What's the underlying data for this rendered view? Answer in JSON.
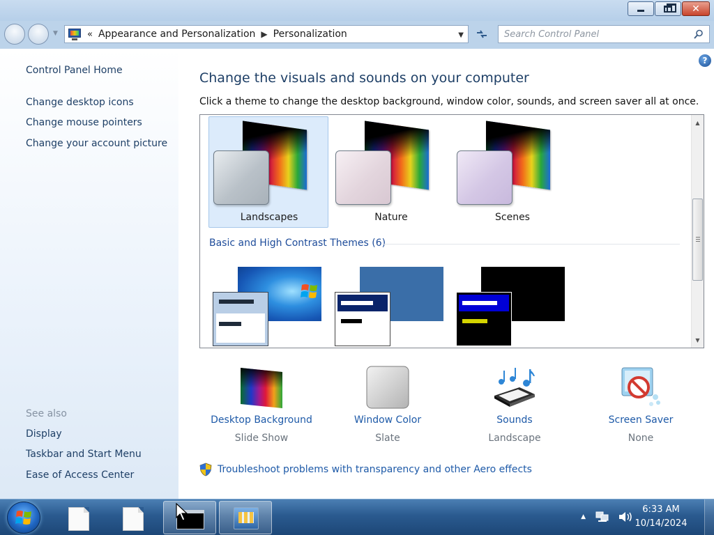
{
  "window": {
    "controls": {
      "minimize": "minimize",
      "maximize": "maximize",
      "close": "close"
    }
  },
  "nav": {
    "breadcrumb": [
      "Appearance and Personalization",
      "Personalization"
    ],
    "breadcrumb_prefix": "«",
    "search_placeholder": "Search Control Panel"
  },
  "sidebar": {
    "home": "Control Panel Home",
    "tasks": [
      "Change desktop icons",
      "Change mouse pointers",
      "Change your account picture"
    ],
    "see_also_label": "See also",
    "see_also": [
      "Display",
      "Taskbar and Start Menu",
      "Ease of Access Center"
    ]
  },
  "main": {
    "title": "Change the visuals and sounds on your computer",
    "subtitle": "Click a theme to change the desktop background, window color, sounds, and screen saver all at once.",
    "themes": [
      {
        "name": "Landscapes",
        "selected": true
      },
      {
        "name": "Nature",
        "selected": false
      },
      {
        "name": "Scenes",
        "selected": false
      }
    ],
    "basic_group_label": "Basic and High Contrast Themes (6)",
    "quick_links": [
      {
        "title": "Desktop Background",
        "value": "Slide Show",
        "icon": "desktop-background-icon"
      },
      {
        "title": "Window Color",
        "value": "Slate",
        "icon": "window-color-icon"
      },
      {
        "title": "Sounds",
        "value": "Landscape",
        "icon": "sounds-icon"
      },
      {
        "title": "Screen Saver",
        "value": "None",
        "icon": "screen-saver-icon"
      }
    ],
    "troubleshoot": "Troubleshoot problems with transparency and other Aero effects"
  },
  "taskbar": {
    "time": "6:33 AM",
    "date": "10/14/2024"
  },
  "colors": {
    "link": "#1e5aa8",
    "title": "#1e3f66",
    "selected_tile": "#dcebfb",
    "taskbar": "#2a5a8f"
  }
}
